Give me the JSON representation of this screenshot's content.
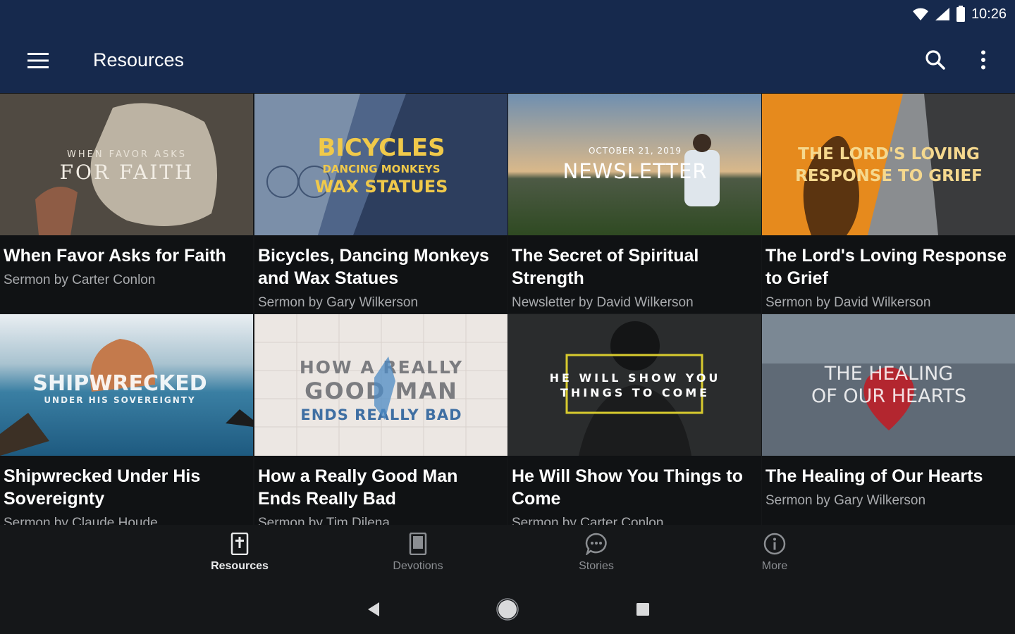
{
  "status_bar": {
    "time": "10:26"
  },
  "app_bar": {
    "title": "Resources"
  },
  "cards": [
    {
      "title": "When Favor Asks for Faith",
      "subtitle": "Sermon by Carter Conlon",
      "art_line1": "WHEN FAVOR ASKS",
      "art_line2": "FOR FAITH"
    },
    {
      "title": "Bicycles, Dancing Monkeys and Wax Statues",
      "subtitle": "Sermon by Gary Wilkerson",
      "art_line1": "BICYCLES",
      "art_line2": "DANCING MONKEYS",
      "art_line3": "WAX STATUES"
    },
    {
      "title": "The Secret of Spiritual Strength",
      "subtitle": "Newsletter by David Wilkerson",
      "art_line1": "OCTOBER 21, 2019",
      "art_line2": "NEWSLETTER"
    },
    {
      "title": "The Lord's Loving Response to Grief",
      "subtitle": "Sermon by David Wilkerson",
      "art_line1": "THE LORD'S LOVING",
      "art_line2": "RESPONSE TO GRIEF"
    },
    {
      "title": "Shipwrecked Under His Sovereignty",
      "subtitle": "Sermon by Claude Houde",
      "art_line1": "SHIPWRECKED",
      "art_line2": "UNDER HIS SOVEREIGNTY"
    },
    {
      "title": "How a Really Good Man Ends Really Bad",
      "subtitle": "Sermon by Tim Dilena",
      "art_line1": "HOW A REALLY",
      "art_line2": "GOOD MAN",
      "art_line3": "ENDS REALLY BAD"
    },
    {
      "title": "He Will Show You Things to Come",
      "subtitle": "Sermon by Carter Conlon",
      "art_line1": "HE WILL SHOW YOU",
      "art_line2": "THINGS TO COME"
    },
    {
      "title": "The Healing of Our Hearts",
      "subtitle": "Sermon by Gary Wilkerson",
      "art_line1": "THE HEALING",
      "art_line2": "OF OUR HEARTS"
    }
  ],
  "bottom_nav": [
    {
      "label": "Resources",
      "icon": "bible-icon",
      "active": true
    },
    {
      "label": "Devotions",
      "icon": "book-icon",
      "active": false
    },
    {
      "label": "Stories",
      "icon": "chat-bubble-icon",
      "active": false
    },
    {
      "label": "More",
      "icon": "info-icon",
      "active": false
    }
  ],
  "colors": {
    "app_bar": "#16294d",
    "background": "#151719",
    "card_bg": "#101214",
    "subtitle": "#a9abae"
  }
}
